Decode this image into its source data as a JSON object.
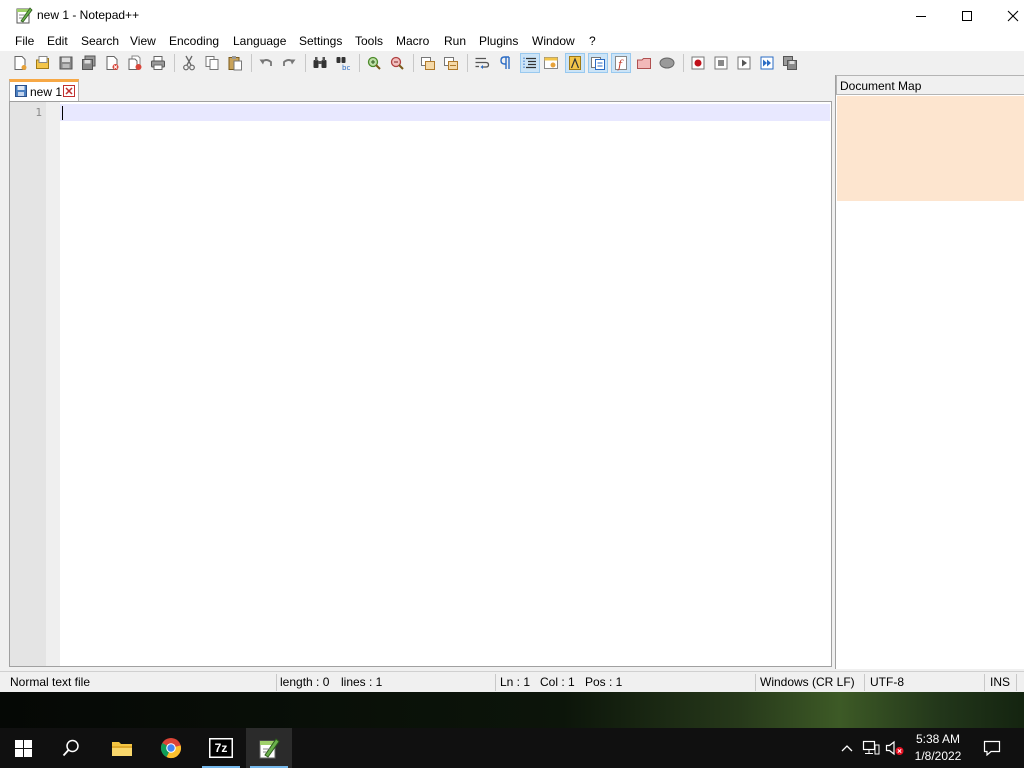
{
  "window": {
    "title": "new 1 - Notepad++"
  },
  "menu": [
    "File",
    "Edit",
    "Search",
    "View",
    "Encoding",
    "Language",
    "Settings",
    "Tools",
    "Macro",
    "Run",
    "Plugins",
    "Window",
    "?"
  ],
  "toolbar_icons": [
    "new-file-icon",
    "open-file-icon",
    "save-icon",
    "save-all-icon",
    "close-icon",
    "close-all-icon",
    "print-icon",
    "cut-icon",
    "copy-icon",
    "paste-icon",
    "undo-icon",
    "redo-icon",
    "find-icon",
    "replace-icon",
    "zoom-in-icon",
    "zoom-out-icon",
    "sync-vertical-icon",
    "sync-horizontal-icon",
    "word-wrap-icon",
    "show-all-characters-icon",
    "indent-guide-icon",
    "udl-icon",
    "document-map-icon",
    "function-list-icon",
    "folder-as-workspace-icon",
    "monitoring-icon",
    "macro-record-icon",
    "macro-stop-icon",
    "macro-play-icon",
    "macro-run-multiple-icon",
    "macro-save-icon"
  ],
  "tabs": [
    {
      "label": "new 1",
      "active": true
    }
  ],
  "editor": {
    "line_numbers": [
      "1"
    ],
    "content": ""
  },
  "document_map": {
    "title": "Document Map"
  },
  "status_bar": {
    "file_type": "Normal text file",
    "length": "length : 0",
    "lines": "lines : 1",
    "ln": "Ln : 1",
    "col": "Col : 1",
    "pos": "Pos : 1",
    "eol": "Windows (CR LF)",
    "encoding": "UTF-8",
    "mode": "INS"
  },
  "taskbar": {
    "apps": [
      "start-icon",
      "search-icon",
      "file-explorer-icon",
      "chrome-icon",
      "7zip-icon",
      "notepad-plus-plus-icon"
    ],
    "zip_label": "7z",
    "clock_time": "5:38 AM",
    "clock_date": "1/8/2022"
  },
  "colors": {
    "current_line": "#e8e8ff",
    "tab_accent": "#f7a845",
    "docmap_viewport": "#fde5cf",
    "taskbar": "#101010"
  }
}
